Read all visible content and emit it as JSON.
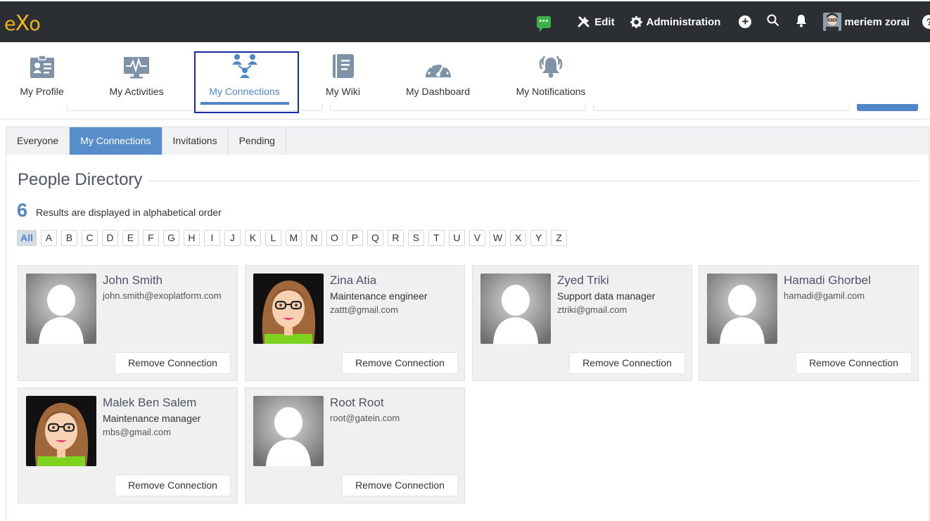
{
  "topbar": {
    "logo": "eXo",
    "chat_icon": "chat-icon",
    "edit_label": "Edit",
    "admin_label": "Administration",
    "user_name": "meriem zorai",
    "help_glyph": "?"
  },
  "appnav": {
    "items": [
      {
        "label": "My Profile",
        "icon": "profile-icon"
      },
      {
        "label": "My Activities",
        "icon": "activity-icon"
      },
      {
        "label": "My Connections",
        "icon": "connections-icon"
      },
      {
        "label": "My Wiki",
        "icon": "wiki-icon"
      },
      {
        "label": "My Dashboard",
        "icon": "dashboard-icon"
      },
      {
        "label": "My Notifications",
        "icon": "notifications-icon"
      }
    ],
    "active": "My Connections"
  },
  "tabs": [
    "Everyone",
    "My Connections",
    "Invitations",
    "Pending"
  ],
  "selected_tab": "My Connections",
  "directory": {
    "title": "People Directory",
    "count": "6",
    "count_text": "Results are displayed in alphabetical order",
    "letters": [
      "All",
      "A",
      "B",
      "C",
      "D",
      "E",
      "F",
      "G",
      "H",
      "I",
      "J",
      "K",
      "L",
      "M",
      "N",
      "O",
      "P",
      "Q",
      "R",
      "S",
      "T",
      "U",
      "V",
      "W",
      "X",
      "Y",
      "Z"
    ],
    "selected_letter": "All"
  },
  "people": [
    {
      "name": "John Smith",
      "position": "",
      "email": "john.smith@exoplatform.com",
      "avatar": "default",
      "action": "Remove Connection"
    },
    {
      "name": "Zina Atia",
      "position": "Maintenance engineer",
      "email": "zattt@gmail.com",
      "avatar": "cartoon",
      "action": "Remove Connection"
    },
    {
      "name": "Zyed Triki",
      "position": "Support data manager",
      "email": "ztriki@gmail.com",
      "avatar": "default",
      "action": "Remove Connection"
    },
    {
      "name": "Hamadi Ghorbel",
      "position": "",
      "email": "hamadi@gamil.com",
      "avatar": "default",
      "action": "Remove Connection"
    },
    {
      "name": "Malek Ben Salem",
      "position": "Maintenance manager",
      "email": "mbs@gmail.com",
      "avatar": "cartoon",
      "action": "Remove Connection"
    },
    {
      "name": "Root Root",
      "position": "",
      "email": "root@gatein.com",
      "avatar": "default",
      "action": "Remove Connection"
    }
  ],
  "colors": {
    "topbar": "#2b2f33",
    "accent": "#4f86c6",
    "logo": "#f2b31c",
    "chat": "#3bb14a",
    "card_bg": "#f0f0f0"
  }
}
